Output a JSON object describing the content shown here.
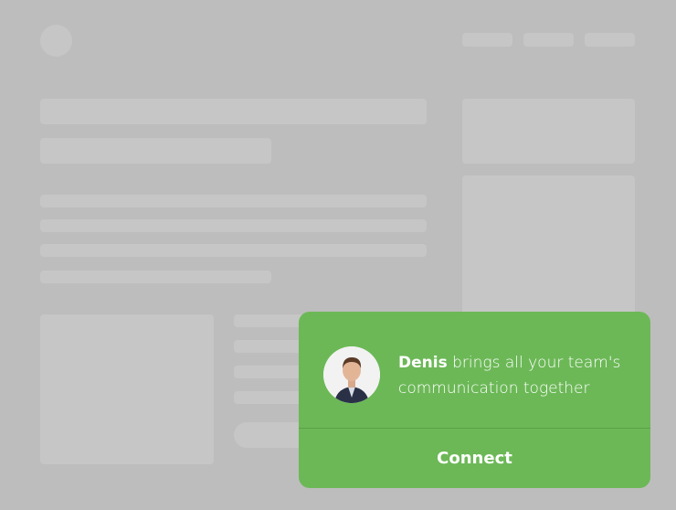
{
  "card": {
    "name": "Denis",
    "message": "brings all your team's communication together",
    "action_label": "Connect",
    "color": "#6cb857"
  },
  "avatar": {
    "icon": "person-avatar-icon"
  }
}
